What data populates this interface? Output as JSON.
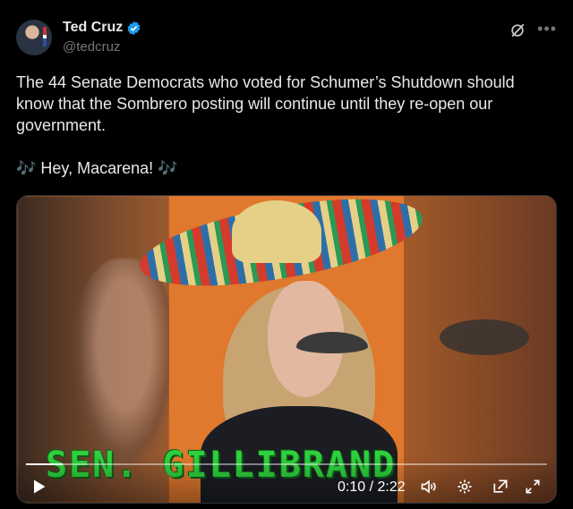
{
  "author": {
    "name": "Ted Cruz",
    "handle": "@tedcruz",
    "verified": true
  },
  "icons": [
    "avatar",
    "verified-badge-icon",
    "grok-icon",
    "more-icon",
    "play-icon",
    "volume-icon",
    "settings-icon",
    "picture-in-picture-icon",
    "fullscreen-icon"
  ],
  "tweet": {
    "text": "The 44 Senate Democrats who voted for Schumer’s Shutdown should know that the Sombrero posting will continue until they re-open our government.\n\n🎶 Hey, Macarena! 🎶"
  },
  "media": {
    "caption": "SEN. GILLIBRAND",
    "time": "0:10 / 2:22",
    "progress": 0.07
  },
  "colors": {
    "background": "#000000",
    "text": "#e7e9ea",
    "muted": "#71767b",
    "verified": "#1d9bf0",
    "caption": "#2fcf3d"
  }
}
